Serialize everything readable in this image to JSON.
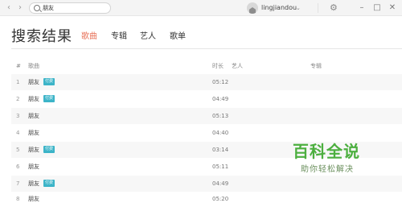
{
  "titlebar": {
    "back_icon": "chevron-left-icon",
    "forward_icon": "chevron-right-icon",
    "search_value": "朋友",
    "username": "lingjiandou",
    "user_menu_icon": "chevron-down-icon",
    "settings_icon": "gear-icon",
    "minimize_icon": "minimize-icon",
    "maximize_icon": "maximize-icon",
    "close_icon": "close-icon"
  },
  "header": {
    "title": "搜索结果",
    "tabs": [
      {
        "label": "歌曲",
        "active": true
      },
      {
        "label": "专辑",
        "active": false
      },
      {
        "label": "艺人",
        "active": false
      },
      {
        "label": "歌单",
        "active": false
      }
    ]
  },
  "table": {
    "columns": {
      "index": "#",
      "song": "歌曲",
      "duration": "时长",
      "artist": "艺人",
      "album": "专辑"
    },
    "rows": [
      {
        "index": "1",
        "title": "朋友",
        "badge": "付费",
        "duration": "05:12"
      },
      {
        "index": "2",
        "title": "朋友",
        "badge": "付费",
        "duration": "04:49"
      },
      {
        "index": "3",
        "title": "朋友",
        "badge": "",
        "duration": "05:13"
      },
      {
        "index": "4",
        "title": "朋友",
        "badge": "",
        "duration": "04:40"
      },
      {
        "index": "5",
        "title": "朋友",
        "badge": "付费",
        "duration": "03:14"
      },
      {
        "index": "6",
        "title": "朋友",
        "badge": "",
        "duration": "05:11"
      },
      {
        "index": "7",
        "title": "朋友",
        "badge": "付费",
        "duration": "04:49"
      },
      {
        "index": "8",
        "title": "朋友",
        "badge": "",
        "duration": "05:20"
      }
    ]
  },
  "watermark": {
    "main": "百科全说",
    "sub": "助你轻松解决"
  },
  "colors": {
    "accent": "#e8735a",
    "badge": "#3cb4c8",
    "watermark": "#4caf3f"
  }
}
